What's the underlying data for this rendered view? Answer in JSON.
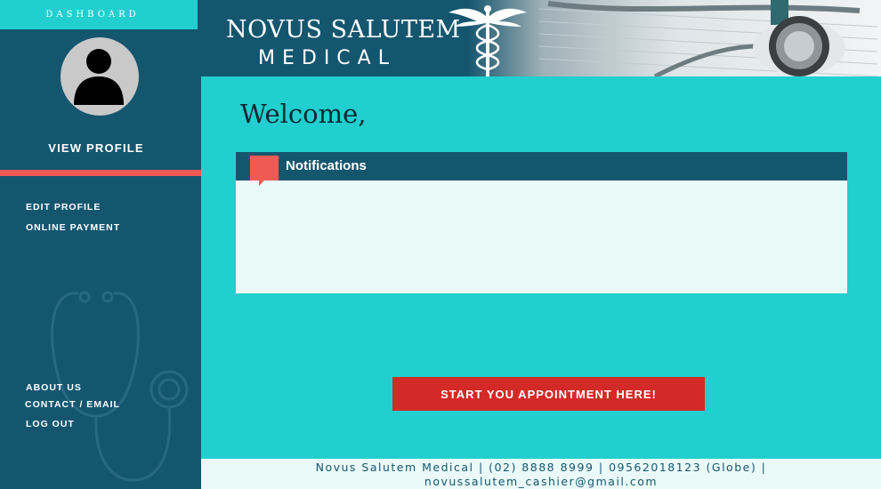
{
  "colors": {
    "teal": "#21cfcf",
    "navy": "#15566f",
    "accent_red": "#d42a27",
    "coral": "#f05a55",
    "panel": "#eafaf9"
  },
  "sidebar": {
    "title": "DASHBOARD",
    "avatar_icon": "user-silhouette-icon",
    "view_profile": "VIEW PROFILE",
    "links": {
      "edit_profile": "EDIT PROFILE",
      "online_payment": "ONLINE PAYMENT",
      "about_us": "ABOUT US",
      "contact_email": "CONTACT / EMAIL",
      "log_out": "LOG OUT"
    },
    "background_icon": "stethoscope-icon"
  },
  "header": {
    "brand_name": "NOVUS SALUTEM",
    "brand_sub": "MEDICAL",
    "logo_icon": "caduceus-icon",
    "photo_icon": "stethoscope-photo"
  },
  "main": {
    "welcome": "Welcome,",
    "notifications": {
      "title": "Notifications",
      "icon": "speech-bubble-icon"
    },
    "cta_label": "START YOU APPOINTMENT HERE!"
  },
  "footer": {
    "line1": "Novus Salutem Medical | (02) 8888 8999 | 09562018123 (Globe) |",
    "line2": "novussalutem_cashier@gmail.com"
  }
}
